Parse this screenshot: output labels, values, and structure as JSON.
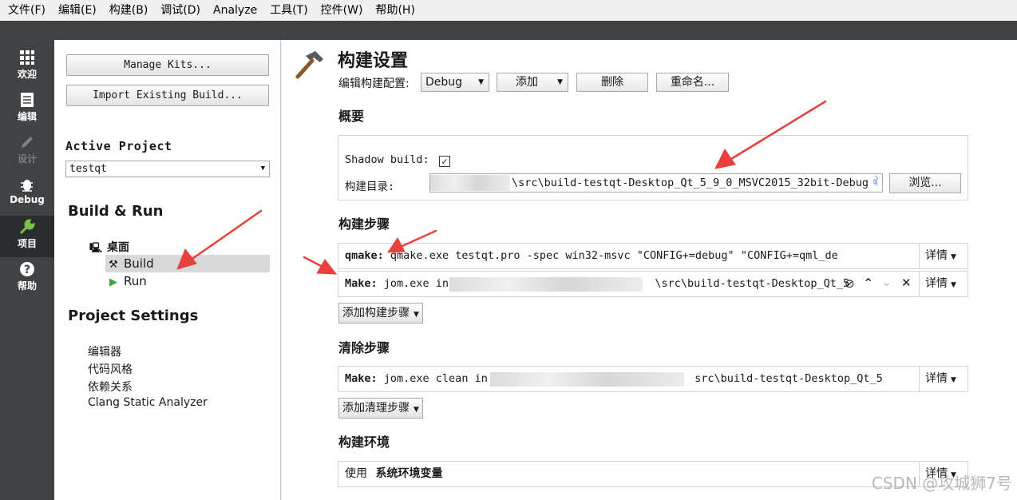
{
  "menu": [
    "文件(F)",
    "编辑(E)",
    "构建(B)",
    "调试(D)",
    "Analyze",
    "工具(T)",
    "控件(W)",
    "帮助(H)"
  ],
  "modes": [
    {
      "label": "欢迎"
    },
    {
      "label": "编辑"
    },
    {
      "label": "设计"
    },
    {
      "label": "Debug"
    },
    {
      "label": "项目"
    },
    {
      "label": "帮助"
    }
  ],
  "sidebar": {
    "manage_kits": "Manage Kits...",
    "import_build": "Import Existing Build...",
    "active_project_label": "Active Project",
    "active_project_value": "testqt",
    "build_run_title": "Build & Run",
    "kit_name": "桌面",
    "build_item": "Build",
    "run_item": "Run",
    "project_settings_title": "Project Settings",
    "settings_items": [
      "编辑器",
      "代码风格",
      "依赖关系",
      "Clang Static Analyzer"
    ]
  },
  "main": {
    "title": "构建设置",
    "edit_config_label": "编辑构建配置:",
    "config_value": "Debug",
    "add_label": "添加",
    "delete_label": "删除",
    "rename_label": "重命名...",
    "overview_title": "概要",
    "shadow_build_label": "Shadow build:",
    "shadow_build_checked": "✓",
    "build_dir_label": "构建目录:",
    "build_dir_value": "\\src\\build-testqt-Desktop_Qt_5_9_0_MSVC2015_32bit-Debug",
    "browse_label": "浏览...",
    "build_steps_title": "构建步骤",
    "qmake_step_name": "qmake:",
    "qmake_step_cmd": "qmake.exe testqt.pro -spec win32-msvc \"CONFIG+=debug\" \"CONFIG+=qml_de",
    "make_step_name": "Make:",
    "make_step_cmd_prefix": "jom.exe in",
    "make_step_cmd_suffix": "\\src\\build-testqt-Desktop_Qt_5",
    "details_label": "详情",
    "add_build_step": "添加构建步骤",
    "clean_steps_title": "清除步骤",
    "clean_step_name": "Make:",
    "clean_step_cmd_prefix": "jom.exe clean in",
    "clean_step_cmd_suffix": "src\\build-testqt-Desktop_Qt_5",
    "add_clean_step": "添加清理步骤",
    "build_env_title": "构建环境",
    "env_use_label": "使用",
    "env_value": "系统环境变量"
  },
  "watermark": "CSDN @攻城狮7号",
  "colors": {
    "mode_bar": "#404244",
    "arrow": "#e8403a"
  }
}
